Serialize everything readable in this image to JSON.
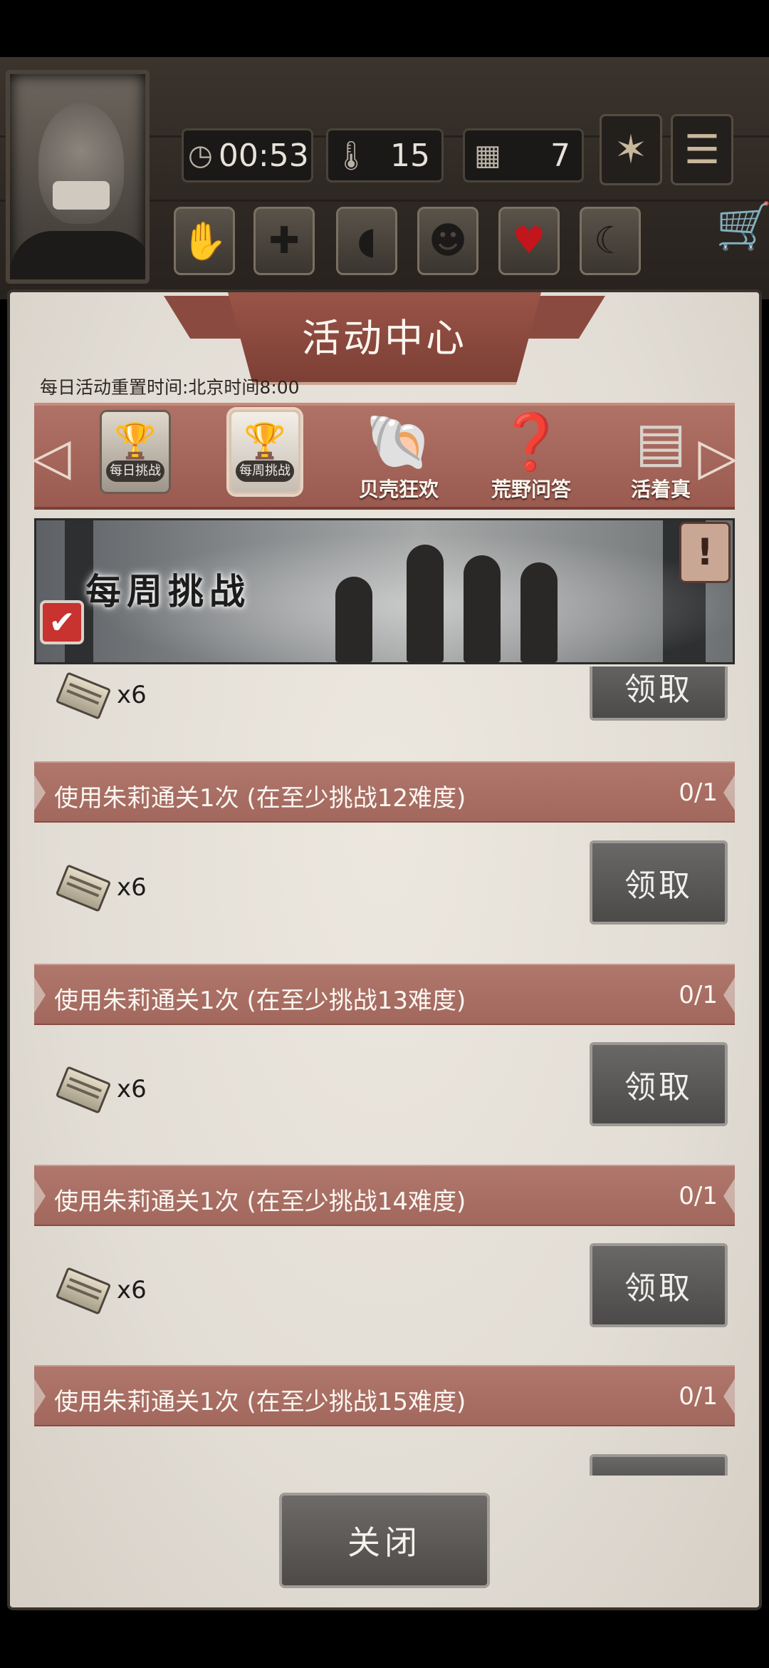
{
  "hud": {
    "time": "00:53",
    "temperature": "15",
    "day": "7"
  },
  "panel": {
    "title": "活动中心",
    "reset_text": "每日活动重置时间:北京时间8:00"
  },
  "tabs": [
    {
      "name": "每日挑战",
      "badge": "每日挑战"
    },
    {
      "name": "每周挑战",
      "badge": "每周挑战"
    },
    {
      "name": "贝壳狂欢"
    },
    {
      "name": "荒野问答"
    },
    {
      "name": "活着真"
    }
  ],
  "banner": {
    "title": "每周挑战",
    "info": "!"
  },
  "rewards": [
    {
      "count": "x6",
      "claim": "领取"
    },
    {
      "count": "x6",
      "claim": "领取"
    },
    {
      "count": "x6",
      "claim": "领取"
    },
    {
      "count": "x6",
      "claim": "领取"
    }
  ],
  "tasks": [
    {
      "text": "使用朱莉通关1次 (在至少挑战12难度)",
      "progress": "0/1"
    },
    {
      "text": "使用朱莉通关1次 (在至少挑战13难度)",
      "progress": "0/1"
    },
    {
      "text": "使用朱莉通关1次 (在至少挑战14难度)",
      "progress": "0/1"
    },
    {
      "text": "使用朱莉通关1次 (在至少挑战15难度)",
      "progress": "0/1"
    }
  ],
  "close_label": "关闭",
  "colors": {
    "ribbon": "#9a5448",
    "task_row": "#a9706a",
    "paper": "#e6e1d9",
    "heart": "#c3151c",
    "check": "#c8322f"
  },
  "icons": {
    "clock": "clock-icon",
    "thermometer": "thermometer-icon",
    "calendar": "calendar-icon",
    "leaf": "maple-leaf-icon",
    "menu": "menu-icon",
    "cart": "cart-icon"
  }
}
